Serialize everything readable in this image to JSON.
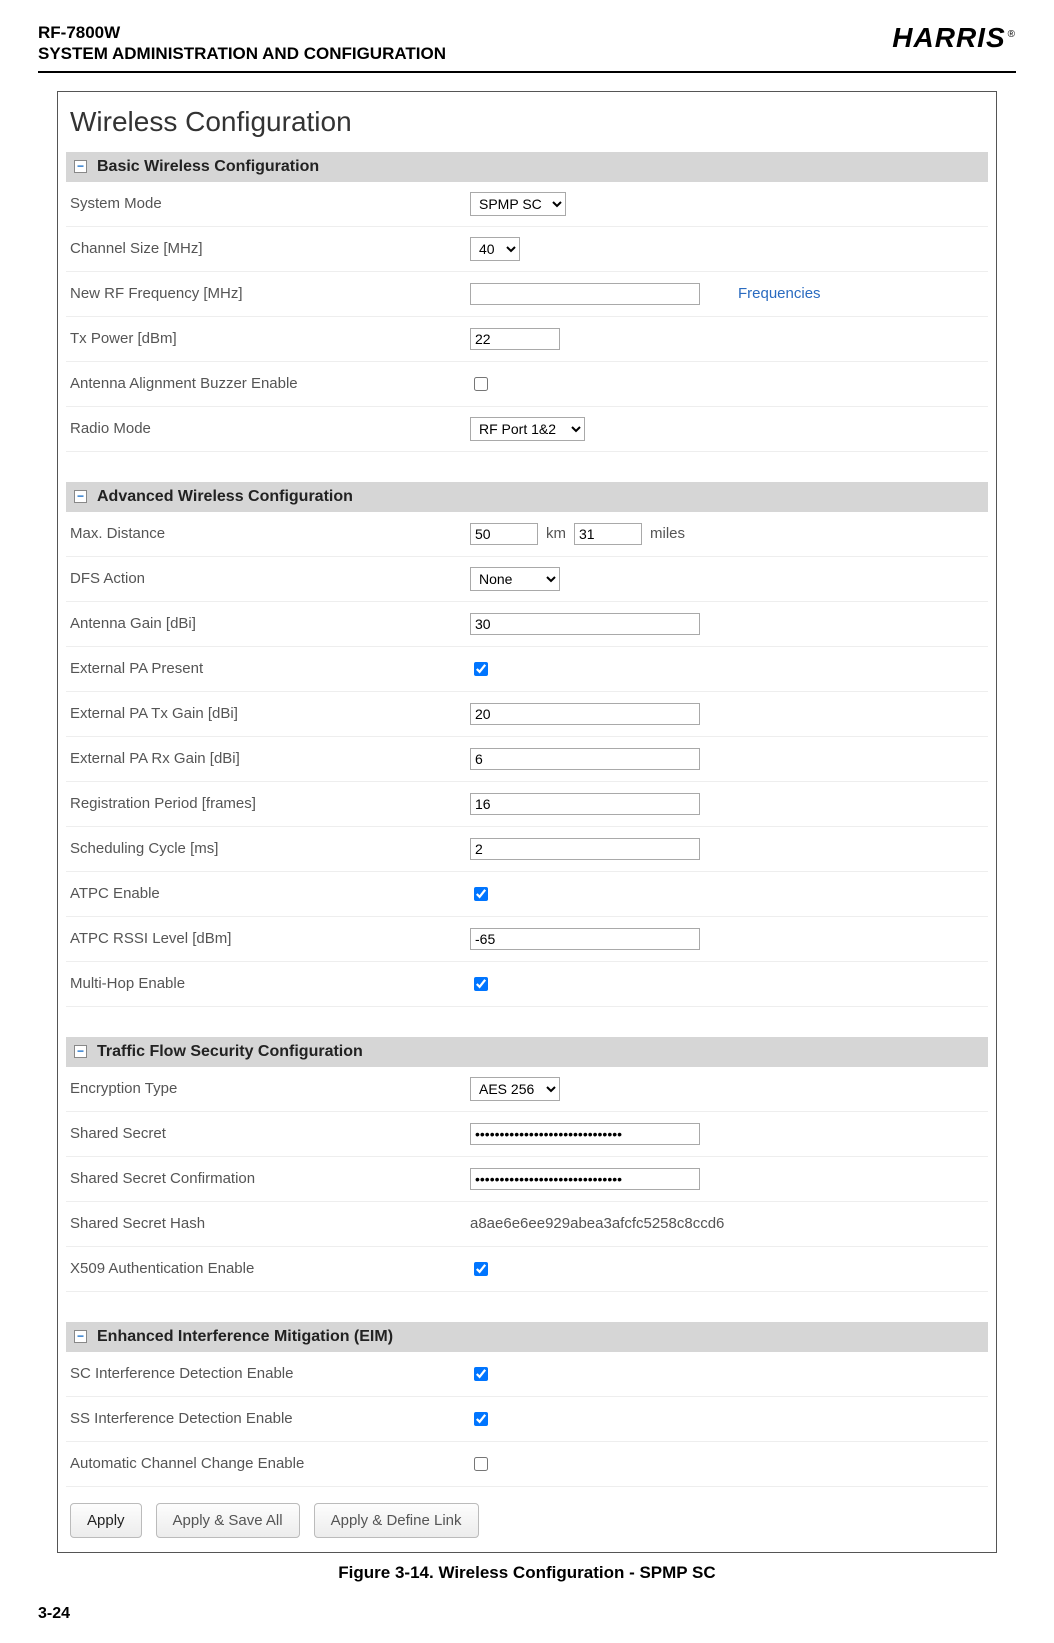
{
  "doc": {
    "model": "RF-7800W",
    "section": "SYSTEM ADMINISTRATION AND CONFIGURATION",
    "brand": "HARRIS",
    "page_number": "3-24",
    "figure_caption": "Figure 3-14.  Wireless Configuration - SPMP SC"
  },
  "page_title": "Wireless Configuration",
  "sections": {
    "basic": {
      "title": "Basic Wireless Configuration"
    },
    "advanced": {
      "title": "Advanced Wireless Configuration"
    },
    "tfs": {
      "title": "Traffic Flow Security Configuration"
    },
    "eim": {
      "title": "Enhanced Interference Mitigation (EIM)"
    }
  },
  "basic": {
    "system_mode_label": "System Mode",
    "system_mode_value": "SPMP SC",
    "channel_size_label": "Channel Size [MHz]",
    "channel_size_value": "40",
    "new_rf_freq_label": "New RF Frequency [MHz]",
    "new_rf_freq_value": "",
    "frequencies_link": "Frequencies",
    "tx_power_label": "Tx Power [dBm]",
    "tx_power_value": "22",
    "buzzer_label": "Antenna Alignment Buzzer Enable",
    "radio_mode_label": "Radio Mode",
    "radio_mode_value": "RF Port 1&2"
  },
  "advanced": {
    "max_distance_label": "Max. Distance",
    "max_distance_km": "50",
    "max_distance_km_unit": "km",
    "max_distance_mi": "31",
    "max_distance_mi_unit": "miles",
    "dfs_label": "DFS Action",
    "dfs_value": "None",
    "antenna_gain_label": "Antenna Gain [dBi]",
    "antenna_gain_value": "30",
    "ext_pa_present_label": "External PA Present",
    "ext_pa_tx_label": "External PA Tx Gain [dBi]",
    "ext_pa_tx_value": "20",
    "ext_pa_rx_label": "External PA Rx Gain [dBi]",
    "ext_pa_rx_value": "6",
    "reg_period_label": "Registration Period [frames]",
    "reg_period_value": "16",
    "sched_cycle_label": "Scheduling Cycle [ms]",
    "sched_cycle_value": "2",
    "atpc_enable_label": "ATPC Enable",
    "atpc_rssi_label": "ATPC RSSI Level [dBm]",
    "atpc_rssi_value": "-65",
    "multihop_label": "Multi-Hop Enable"
  },
  "tfs": {
    "enc_type_label": "Encryption Type",
    "enc_type_value": "AES 256",
    "shared_secret_label": "Shared Secret",
    "shared_secret_value": "••••••••••••••••••••••••••••••",
    "shared_secret_conf_label": "Shared Secret Confirmation",
    "shared_secret_conf_value": "••••••••••••••••••••••••••••••",
    "hash_label": "Shared Secret Hash",
    "hash_value": "a8ae6e6ee929abea3afcfc5258c8ccd6",
    "x509_label": "X509 Authentication Enable"
  },
  "eim": {
    "sc_label": "SC Interference Detection Enable",
    "ss_label": "SS Interference Detection Enable",
    "auto_ch_label": "Automatic Channel Change Enable"
  },
  "buttons": {
    "apply": "Apply",
    "apply_save": "Apply & Save All",
    "apply_define": "Apply & Define Link"
  }
}
